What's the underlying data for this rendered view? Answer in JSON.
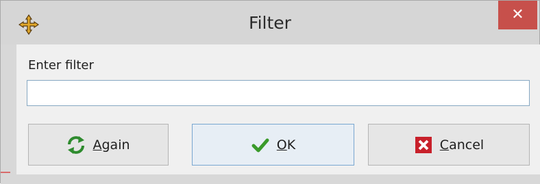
{
  "window": {
    "title": "Filter",
    "close_symbol": "✕",
    "icon": "move-arrows-icon"
  },
  "form": {
    "label": "Enter filter",
    "input_value": "",
    "input_placeholder": ""
  },
  "buttons": {
    "again": {
      "mnemonic": "A",
      "rest": "gain",
      "icon": "refresh-icon"
    },
    "ok": {
      "mnemonic": "O",
      "rest": "K",
      "icon": "checkmark-icon"
    },
    "cancel": {
      "mnemonic": "C",
      "rest": "ancel",
      "icon": "cancel-x-icon"
    }
  },
  "colors": {
    "close_button": "#c7504b",
    "input_border": "#86a7c2",
    "ok_border": "#78a6d0",
    "again_icon": "#2e8b2e",
    "ok_icon": "#3a9a2a",
    "cancel_icon": "#c8202a"
  }
}
